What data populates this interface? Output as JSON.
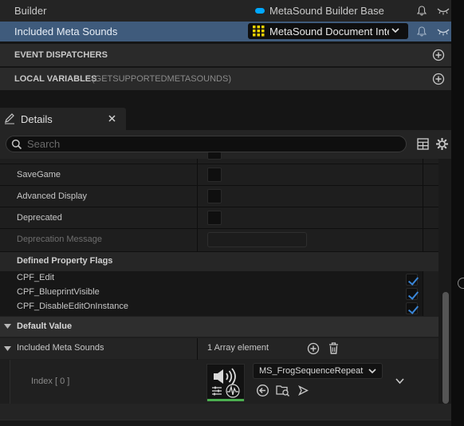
{
  "variables": [
    {
      "name": "Builder",
      "type": "MetaSound Builder Base",
      "type_color": "#00a8ff"
    },
    {
      "name": "Included Meta Sounds",
      "type": "MetaSound Document Inte"
    }
  ],
  "sections": {
    "event_dispatchers": "EVENT DISPATCHERS",
    "local_variables": "LOCAL VARIABLES",
    "local_variables_scope": "(GETSUPPORTEDMETASOUNDS)"
  },
  "details": {
    "tab_title": "Details",
    "search_placeholder": "Search"
  },
  "properties": {
    "save_game": "SaveGame",
    "advanced_display": "Advanced Display",
    "deprecated": "Deprecated",
    "deprecation_message": "Deprecation Message",
    "defined_property_flags": "Defined Property Flags",
    "flags": [
      "CPF_Edit",
      "CPF_BlueprintVisible",
      "CPF_DisableEditOnInstance"
    ]
  },
  "default_value": {
    "header": "Default Value",
    "array_name": "Included Meta Sounds",
    "array_count": "1 Array element",
    "index_label": "Index [ 0 ]",
    "asset_name": "MS_FrogSequenceRepeat"
  },
  "colors": {
    "accent": "#3a86d8",
    "selected_row": "#3f5b7c",
    "asset_underline": "#4caf50"
  }
}
